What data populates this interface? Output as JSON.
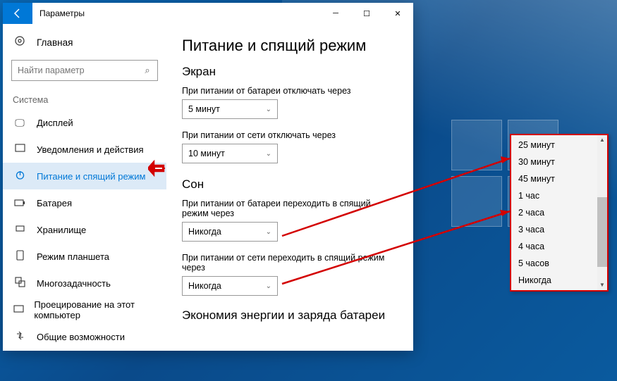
{
  "window": {
    "title": "Параметры"
  },
  "sidebar": {
    "home_label": "Главная",
    "search_placeholder": "Найти параметр",
    "category_label": "Система",
    "items": [
      {
        "label": "Дисплей",
        "icon": "display-icon",
        "glyph": "🖵"
      },
      {
        "label": "Уведомления и действия",
        "icon": "notifications-icon",
        "glyph": "▭"
      },
      {
        "label": "Питание и спящий режим",
        "icon": "power-icon",
        "glyph": "⏻"
      },
      {
        "label": "Батарея",
        "icon": "battery-icon",
        "glyph": "▭"
      },
      {
        "label": "Хранилище",
        "icon": "storage-icon",
        "glyph": "▭"
      },
      {
        "label": "Режим планшета",
        "icon": "tablet-icon",
        "glyph": "▱"
      },
      {
        "label": "Многозадачность",
        "icon": "multitask-icon",
        "glyph": "⧉"
      },
      {
        "label": "Проецирование на этот компьютер",
        "icon": "project-icon",
        "glyph": "▭"
      },
      {
        "label": "Общие возможности",
        "icon": "shared-icon",
        "glyph": "⇄"
      }
    ]
  },
  "content": {
    "page_title": "Питание и спящий режим",
    "screen": {
      "title": "Экран",
      "battery_label": "При питании от батареи отключать через",
      "battery_value": "5 минут",
      "plugged_label": "При питании от сети отключать через",
      "plugged_value": "10 минут"
    },
    "sleep": {
      "title": "Сон",
      "battery_label": "При питании от батареи переходить в спящий режим через",
      "battery_value": "Никогда",
      "plugged_label": "При питании от сети переходить в спящий режим через",
      "plugged_value": "Никогда"
    },
    "energy_title": "Экономия энергии и заряда батареи"
  },
  "dropdown": {
    "options": [
      "25 минут",
      "30 минут",
      "45 минут",
      "1 час",
      "2 часа",
      "3 часа",
      "4 часа",
      "5 часов",
      "Никогда"
    ]
  }
}
